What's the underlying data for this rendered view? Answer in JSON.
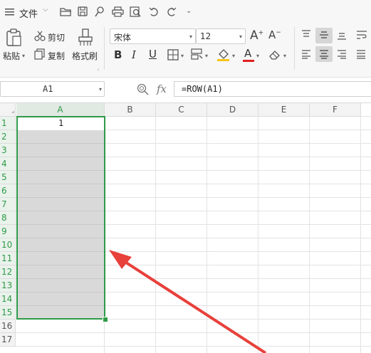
{
  "quickbar": {
    "menu_label": "文件",
    "icons": [
      "hamburger-menu-icon",
      "open-folder-icon",
      "save-icon",
      "format-painter-small-icon",
      "print-icon",
      "print-preview-icon",
      "undo-icon",
      "redo-icon",
      "more-icon"
    ]
  },
  "ribbon": {
    "paste_label": "粘贴",
    "cut_label": "剪切",
    "copy_label": "复制",
    "format_painter_label": "格式刷",
    "font_name": "宋体",
    "font_size": "12",
    "bold": "B",
    "italic": "I",
    "underline": "U",
    "font_color_letter": "A",
    "increase_font": "A",
    "decrease_font": "A"
  },
  "formula_bar": {
    "name_box": "A1",
    "fx_label": "fx",
    "formula": "=ROW(A1)"
  },
  "sheet": {
    "columns": [
      "A",
      "B",
      "C",
      "D",
      "E",
      "F"
    ],
    "rows": [
      "1",
      "2",
      "3",
      "4",
      "5",
      "6",
      "7",
      "8",
      "9",
      "10",
      "11",
      "12",
      "13",
      "14",
      "15",
      "16",
      "17"
    ],
    "cell_a1": "1",
    "selection": "A1:A15"
  },
  "colors": {
    "accent": "#2e9b47",
    "selection_fill": "#d9d9d9",
    "arrow": "#e8403a",
    "font_color_bar": "#e02020",
    "fill_color_bar": "#f5c518"
  }
}
